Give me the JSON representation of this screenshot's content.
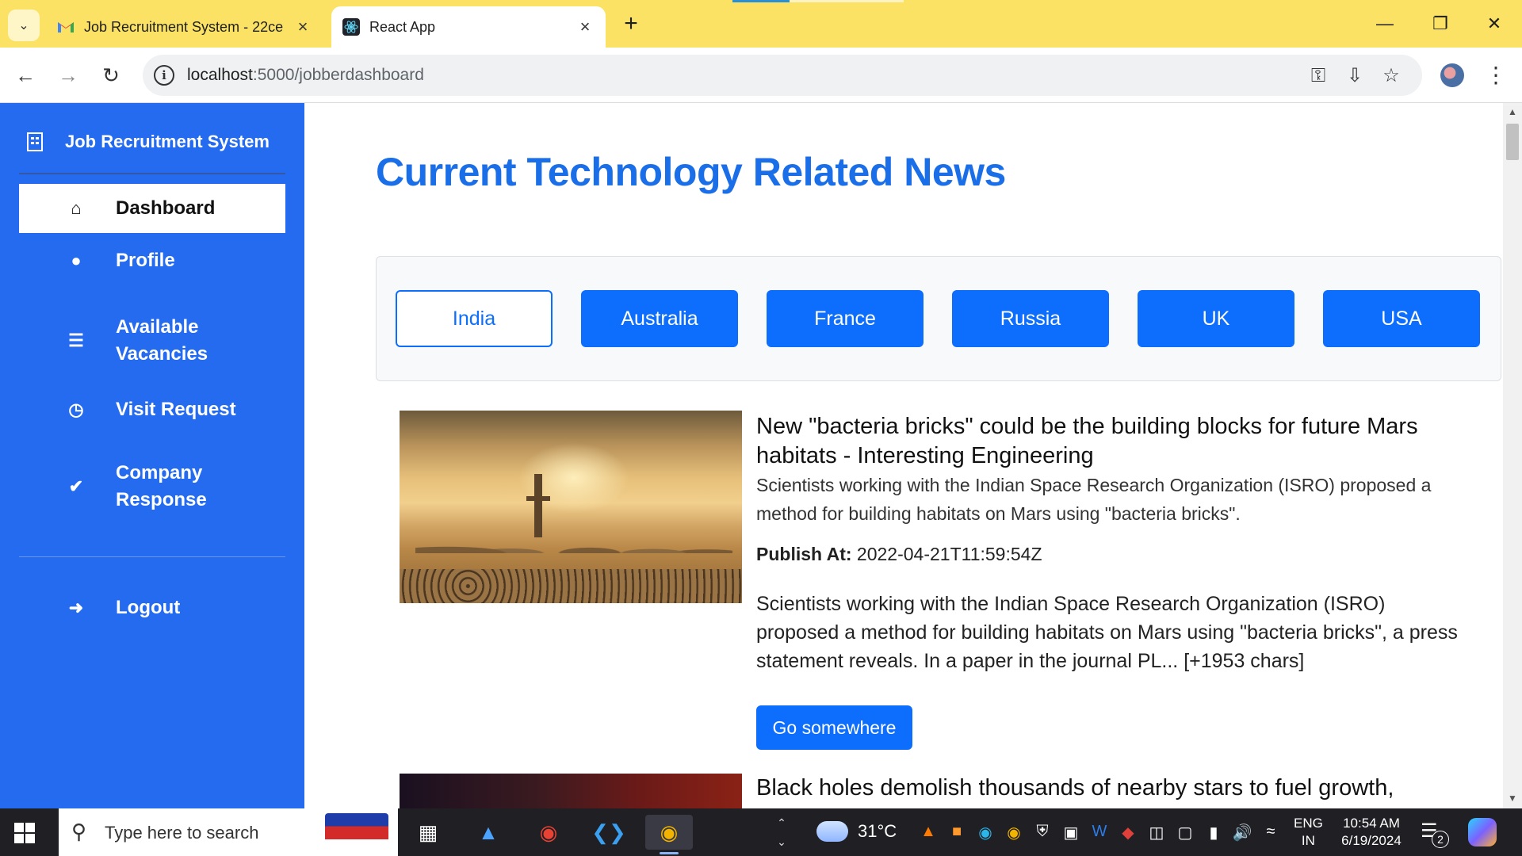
{
  "browser": {
    "tabs": [
      {
        "title": "Job Recruitment System - 22ce",
        "active": false,
        "favicon": "gmail-icon"
      },
      {
        "title": "React App",
        "active": true,
        "favicon": "react-icon"
      }
    ],
    "url_host": "localhost",
    "url_path": ":5000/jobberdashboard"
  },
  "sidebar": {
    "brand": "Job Recruitment System",
    "items": [
      {
        "label": "Dashboard",
        "icon": "home-icon",
        "active": true
      },
      {
        "label": "Profile",
        "icon": "user-icon",
        "active": false
      },
      {
        "label": "Available Vacancies",
        "icon": "list-icon",
        "active": false
      },
      {
        "label": "Visit Request",
        "icon": "clock-icon",
        "active": false
      },
      {
        "label": "Company Response",
        "icon": "check-icon",
        "active": false
      }
    ],
    "logout": "Logout"
  },
  "main": {
    "title": "Current Technology Related News",
    "countries": [
      "India",
      "Australia",
      "France",
      "Russia",
      "UK",
      "USA"
    ],
    "selected_country": "India",
    "articles": [
      {
        "title": "New \"bacteria bricks\" could be the building blocks for future Mars habitats - Interesting Engineering",
        "description": "Scientists working with the Indian Space Research Organization (ISRO) proposed a method for building habitats on Mars using \"bacteria bricks\".",
        "publish_label": "Publish At:",
        "publish_at": "2022-04-21T11:59:54Z",
        "content": "Scientists working with the Indian Space Research Organization (ISRO) proposed a method for building habitats on Mars using \"bacteria bricks\", a press statement reveals. In a paper in the journal PL... [+1953 chars]",
        "button": "Go somewhere"
      },
      {
        "title": "Black holes demolish thousands of nearby stars to fuel growth,"
      }
    ]
  },
  "taskbar": {
    "search_placeholder": "Type here to search",
    "temperature": "31°C",
    "lang_line1": "ENG",
    "lang_line2": "IN",
    "time": "10:54 AM",
    "date": "6/19/2024",
    "notification_count": "2"
  },
  "colors": {
    "sidebar": "#246bf0",
    "primary": "#0d6efd",
    "title": "#1a6fe8",
    "tabbar": "#fbe264"
  }
}
